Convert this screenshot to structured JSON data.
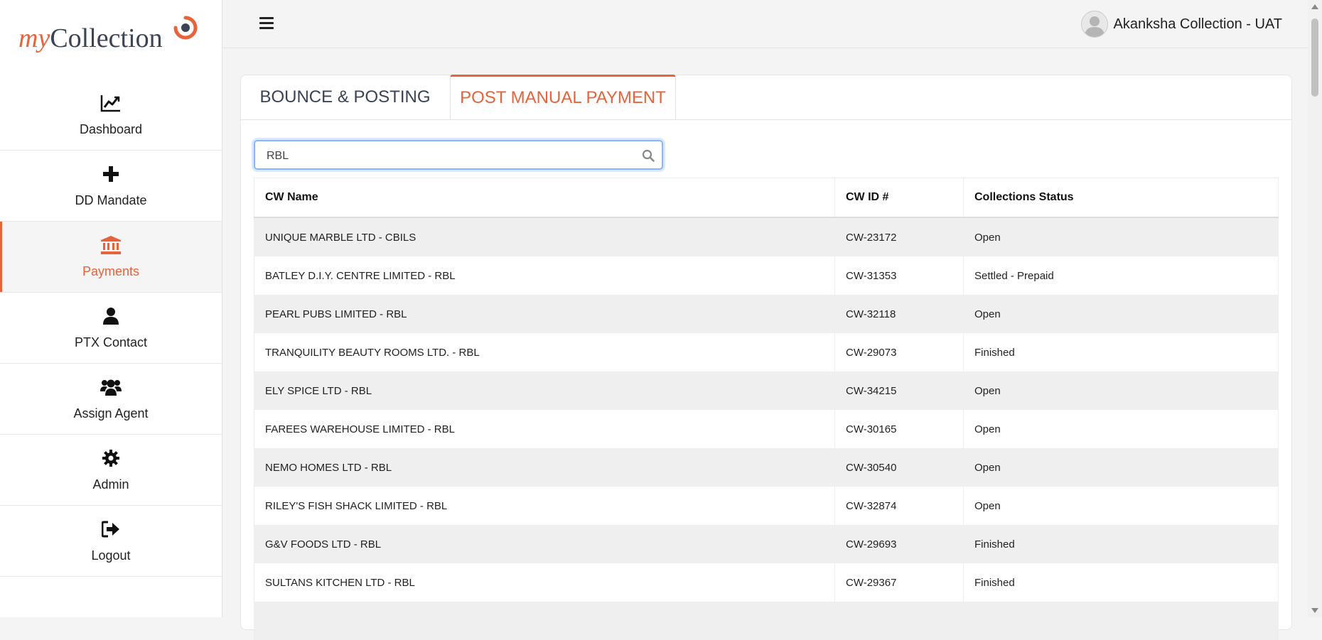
{
  "app": {
    "logo_my": "my",
    "logo_rest": "Collection"
  },
  "sidebar": {
    "items": [
      {
        "label": "Dashboard",
        "icon": "chart-line-icon",
        "active": false
      },
      {
        "label": "DD Mandate",
        "icon": "plus-icon",
        "active": false
      },
      {
        "label": "Payments",
        "icon": "bank-icon",
        "active": true
      },
      {
        "label": "PTX Contact",
        "icon": "user-icon",
        "active": false
      },
      {
        "label": "Assign Agent",
        "icon": "users-icon",
        "active": false
      },
      {
        "label": "Admin",
        "icon": "gear-icon",
        "active": false
      },
      {
        "label": "Logout",
        "icon": "sign-out-icon",
        "active": false
      }
    ]
  },
  "header": {
    "user_name": "Akanksha Collection - UAT"
  },
  "tabs": {
    "bounce": "BOUNCE & POSTING",
    "manual": "POST MANUAL PAYMENT",
    "active": "manual"
  },
  "search": {
    "value": "RBL",
    "placeholder": ""
  },
  "table": {
    "headers": [
      "CW Name",
      "CW ID #",
      "Collections Status"
    ],
    "rows": [
      [
        "UNIQUE MARBLE LTD - CBILS",
        "CW-23172",
        "Open"
      ],
      [
        "BATLEY D.I.Y. CENTRE LIMITED - RBL",
        "CW-31353",
        "Settled - Prepaid"
      ],
      [
        "PEARL PUBS LIMITED - RBL",
        "CW-32118",
        "Open"
      ],
      [
        "TRANQUILITY BEAUTY ROOMS LTD. - RBL",
        "CW-29073",
        "Finished"
      ],
      [
        "ELY SPICE LTD - RBL",
        "CW-34215",
        "Open"
      ],
      [
        "FAREES WAREHOUSE LIMITED - RBL",
        "CW-30165",
        "Open"
      ],
      [
        "NEMO HOMES LTD - RBL",
        "CW-30540",
        "Open"
      ],
      [
        "RILEY'S FISH SHACK LIMITED - RBL",
        "CW-32874",
        "Open"
      ],
      [
        "G&V FOODS LTD - RBL",
        "CW-29693",
        "Finished"
      ],
      [
        "SULTANS KITCHEN LTD - RBL",
        "CW-29367",
        "Finished"
      ],
      [
        "",
        "",
        ""
      ]
    ]
  },
  "colors": {
    "accent": "#e8623a",
    "text": "#222222",
    "stripe": "#efefef"
  }
}
